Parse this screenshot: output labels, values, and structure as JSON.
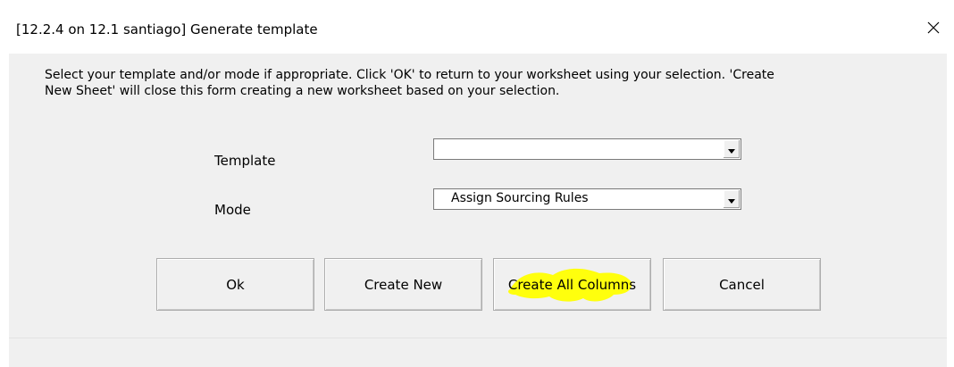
{
  "window": {
    "title": "[12.2.4 on 12.1 santiago] Generate template"
  },
  "instructions": {
    "line1": "Select your template and/or mode if appropriate. Click 'OK' to return to your worksheet using your selection.  'Create",
    "line2": "New Sheet' will close this form creating a new worksheet based on your selection."
  },
  "fields": {
    "template": {
      "label": "Template",
      "value": ""
    },
    "mode": {
      "label": "Mode",
      "value": "Assign Sourcing Rules"
    }
  },
  "buttons": {
    "ok": "Ok",
    "create_new": "Create New",
    "create_all_columns": "Create All Columns",
    "cancel": "Cancel"
  },
  "colors": {
    "form_background": "#f0f0f0",
    "highlight": "#ffff00"
  },
  "icons": {
    "close": "close-icon",
    "dropdown": "dropdown-arrow-icon"
  }
}
